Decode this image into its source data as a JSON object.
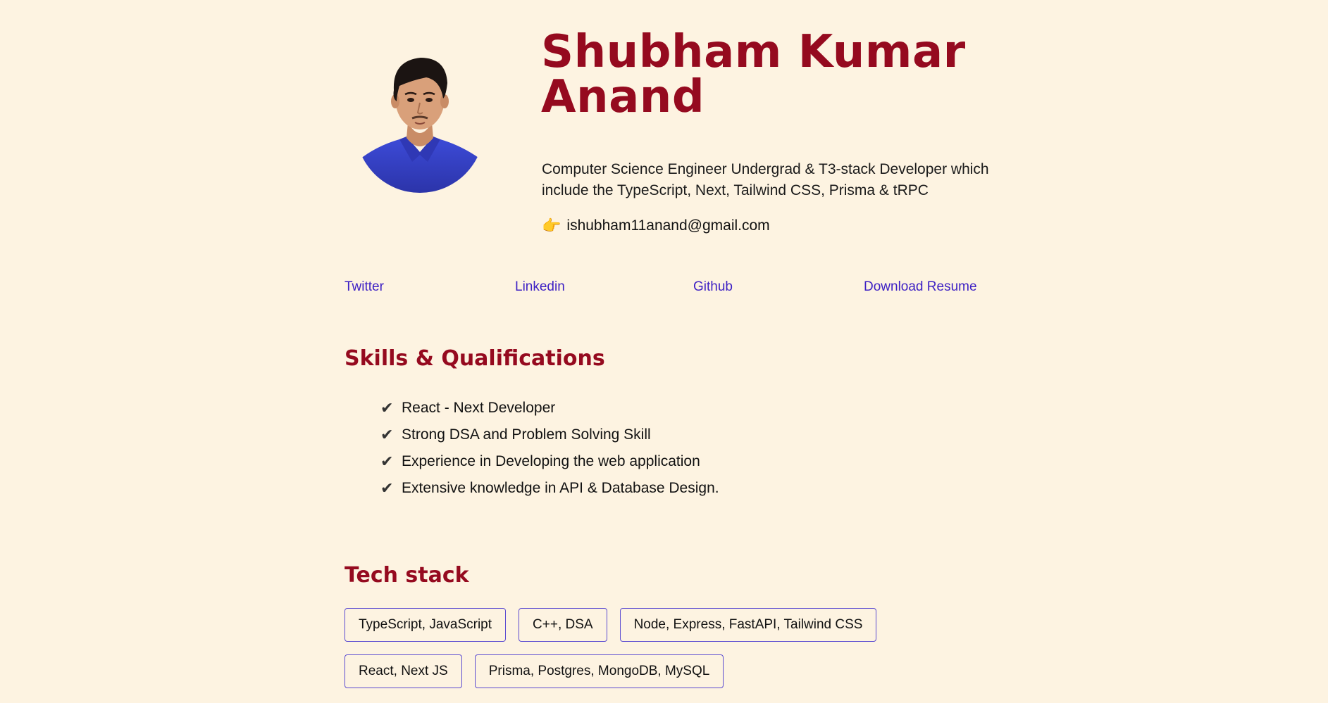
{
  "profile": {
    "name": "Shubham Kumar Anand",
    "tagline": "Computer Science Engineer Undergrad & T3-stack Developer which include the TypeScript, Next, Tailwind CSS, Prisma & tRPC",
    "email_pointer": "👉",
    "email": "ishubham11anand@gmail.com"
  },
  "links": {
    "twitter": "Twitter",
    "linkedin": "Linkedin",
    "github": "Github",
    "resume": "Download Resume"
  },
  "skills": {
    "title": "Skills & Qualifications",
    "check_glyph": "✔",
    "items": [
      "React - Next Developer",
      "Strong DSA and Problem Solving Skill",
      "Experience in Developing the web application",
      "Extensive knowledge in API & Database Design."
    ]
  },
  "tech_stack": {
    "title": "Tech stack",
    "row1": [
      "TypeScript, JavaScript",
      "C++, DSA",
      "Node, Express, FastAPI, Tailwind CSS"
    ],
    "row2": [
      "React, Next JS",
      "Prisma, Postgres, MongoDB, MySQL"
    ]
  },
  "colors": {
    "background": "#fdf3e1",
    "heading": "#950a1f",
    "link": "#3c1fc4",
    "chip_border": "#5b4bd1",
    "shirt": "#3a43c9"
  },
  "icons": {
    "avatar": "profile-photo",
    "email": "pointing-hand-icon",
    "skill_bullet": "check-mark-icon"
  }
}
